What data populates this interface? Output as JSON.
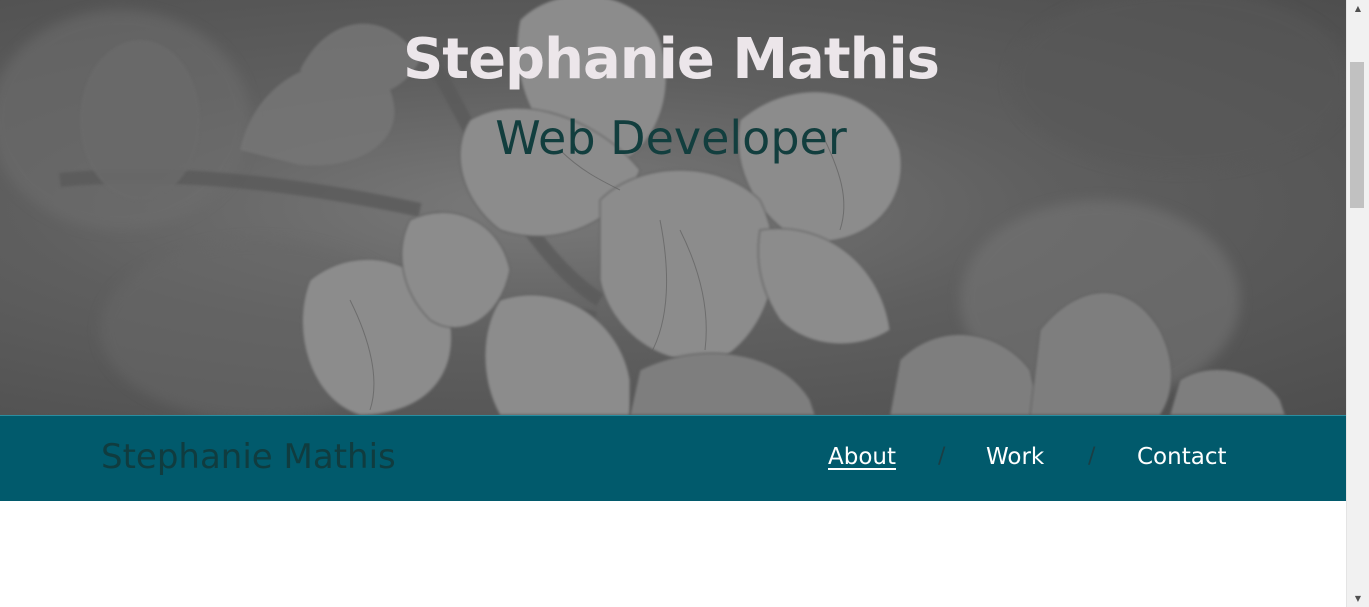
{
  "hero": {
    "name": "Stephanie Mathis",
    "role": "Web Developer"
  },
  "navbar": {
    "brand": "Stephanie Mathis",
    "links": [
      {
        "label": "About",
        "active": true
      },
      {
        "label": "Work",
        "active": false
      },
      {
        "label": "Contact",
        "active": false
      }
    ],
    "separator": "/"
  },
  "scrollbar": {
    "up_icon": "triangle-up-icon",
    "down_icon": "triangle-down-icon"
  },
  "colors": {
    "navbar_bg": "#015a6c",
    "hero_name": "#ece6ea",
    "hero_role": "#123e3e",
    "brand_text": "#103c3f"
  }
}
